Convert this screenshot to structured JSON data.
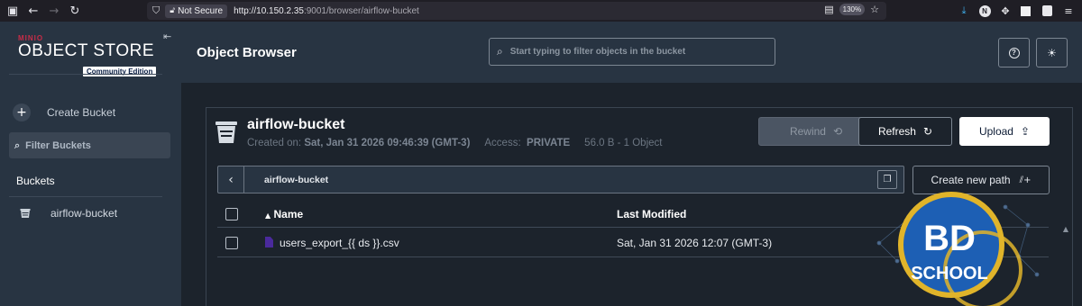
{
  "browser": {
    "security_label": "Not Secure",
    "url_host": "http://10.150.2.35",
    "url_path": ":9001/browser/airflow-bucket",
    "zoom": "130%"
  },
  "sidebar": {
    "brand_top": "MINIO",
    "brand_main": "OBJECT STORE",
    "brand_edition": "Community Edition",
    "create_bucket_label": "Create Bucket",
    "filter_buckets_label": "Filter Buckets",
    "buckets_title": "Buckets",
    "buckets": [
      {
        "label": "airflow-bucket"
      }
    ]
  },
  "header": {
    "title": "Object Browser",
    "search_placeholder": "Start typing to filter objects in the bucket"
  },
  "bucket": {
    "name": "airflow-bucket",
    "created_label": "Created on:",
    "created_value": "Sat, Jan 31 2026 09:46:39 (GMT-3)",
    "access_label": "Access:",
    "access_value": "PRIVATE",
    "usage": "56.0 B - 1 Object"
  },
  "actions": {
    "rewind": "Rewind",
    "refresh": "Refresh",
    "upload": "Upload",
    "create_path": "Create new path"
  },
  "path": {
    "current": "airflow-bucket"
  },
  "table": {
    "columns": [
      "Name",
      "Last Modified"
    ],
    "rows": [
      {
        "name": "users_export_{{ ds }}.csv",
        "last_modified": "Sat, Jan 31 2026 12:07 (GMT-3)"
      }
    ]
  },
  "watermark": {
    "line1": "BD",
    "line2": "SCHOOL"
  },
  "colors": {
    "sidebar_bg": "#283442",
    "main_bg": "#1c232c",
    "accent_red": "#c72c48",
    "watermark_gold": "#e0b42a",
    "watermark_blue": "#1d5fb4"
  }
}
